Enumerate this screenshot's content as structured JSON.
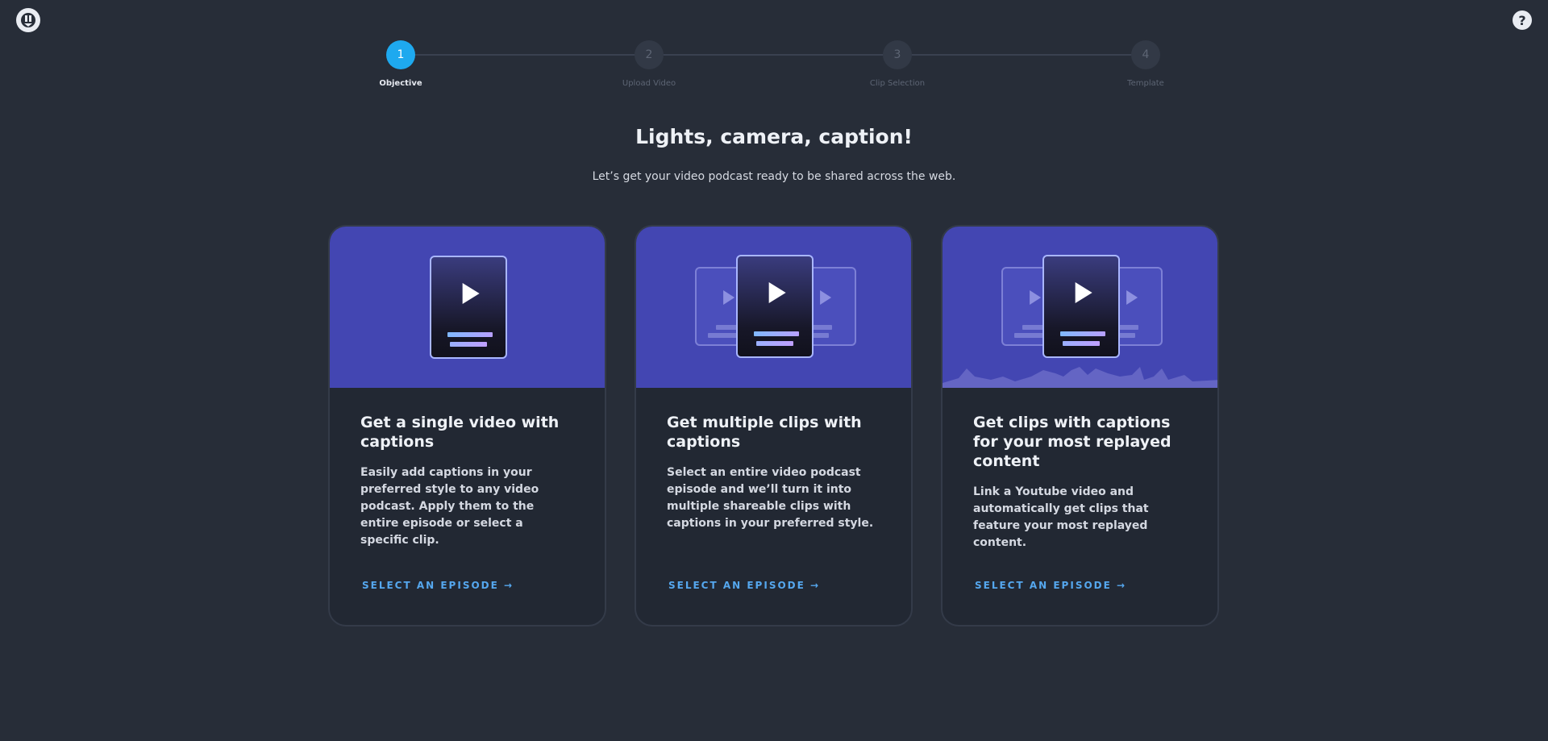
{
  "header": {
    "help_icon": "?"
  },
  "steps": [
    {
      "number": "1",
      "label": "Objective",
      "active": true
    },
    {
      "number": "2",
      "label": "Upload Video",
      "active": false
    },
    {
      "number": "3",
      "label": "Clip Selection",
      "active": false
    },
    {
      "number": "4",
      "label": "Template",
      "active": false
    }
  ],
  "main": {
    "title": "Lights, camera, caption!",
    "subtitle": "Let’s get your video podcast ready to be shared across the web."
  },
  "cards": [
    {
      "title": "Get a single video with captions",
      "description": "Easily add captions in your preferred style to any video podcast. Apply them to the entire episode or select a specific clip.",
      "cta": "SELECT AN EPISODE →"
    },
    {
      "title": "Get multiple clips with captions",
      "description": "Select an entire video podcast episode and we’ll turn it into multiple shareable clips with captions in your preferred style.",
      "cta": "SELECT AN EPISODE →"
    },
    {
      "title": "Get clips with captions for your most replayed content",
      "description": "Link a Youtube video and automatically get clips that feature your most replayed content.",
      "cta": "SELECT AN EPISODE →"
    }
  ],
  "colors": {
    "accent": "#1ea9ef",
    "card_hero": "#4346b2",
    "background": "#272d38",
    "cta": "#55a7ee"
  }
}
